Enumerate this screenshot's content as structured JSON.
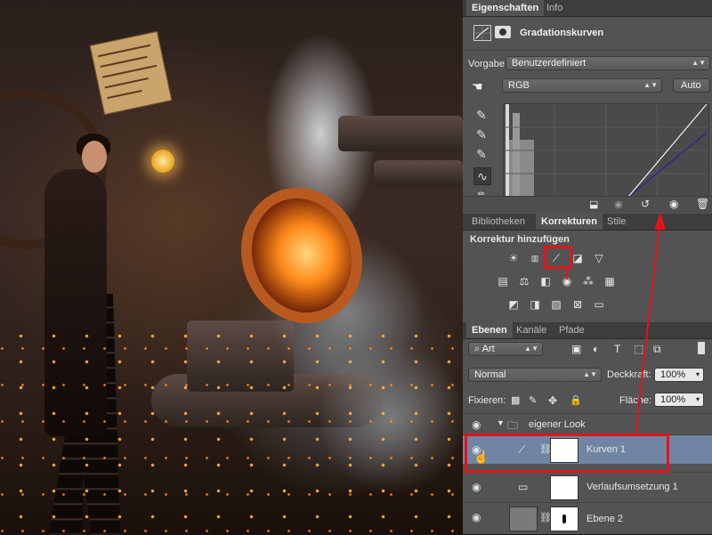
{
  "properties_panel": {
    "tabs": [
      {
        "label": "Eigenschaften"
      },
      {
        "label": "Info"
      }
    ],
    "title": "Gradationskurven",
    "preset_label": "Vorgabe:",
    "preset_value": "Benutzerdefiniert",
    "channel_value": "RGB",
    "auto_label": "Auto"
  },
  "adjustments_panel": {
    "tabs": [
      {
        "label": "Bibliotheken"
      },
      {
        "label": "Korrekturen"
      },
      {
        "label": "Stile"
      }
    ],
    "heading": "Korrektur hinzufügen"
  },
  "layers_panel": {
    "tabs": [
      {
        "label": "Ebenen"
      },
      {
        "label": "Kanäle"
      },
      {
        "label": "Pfade"
      }
    ],
    "filter_kind": "Art",
    "blend_mode": "Normal",
    "opacity_label": "Deckkraft:",
    "opacity_value": "100%",
    "lock_label": "Fixieren:",
    "fill_label": "Fläche:",
    "fill_value": "100%",
    "layers": [
      {
        "name": "eigener Look",
        "type": "group"
      },
      {
        "name": "Kurven 1",
        "type": "curves",
        "selected": true
      },
      {
        "name": "Verlaufsumsetzung 1",
        "type": "gradient-map"
      },
      {
        "name": "Ebene 2",
        "type": "pixel"
      }
    ]
  },
  "canvas_sign": {
    "lines": [
      "Schauen",
      "durch",
      "eigen",
      "Arbeit",
      "vorsicht"
    ]
  },
  "accent_color": "#e0151b"
}
